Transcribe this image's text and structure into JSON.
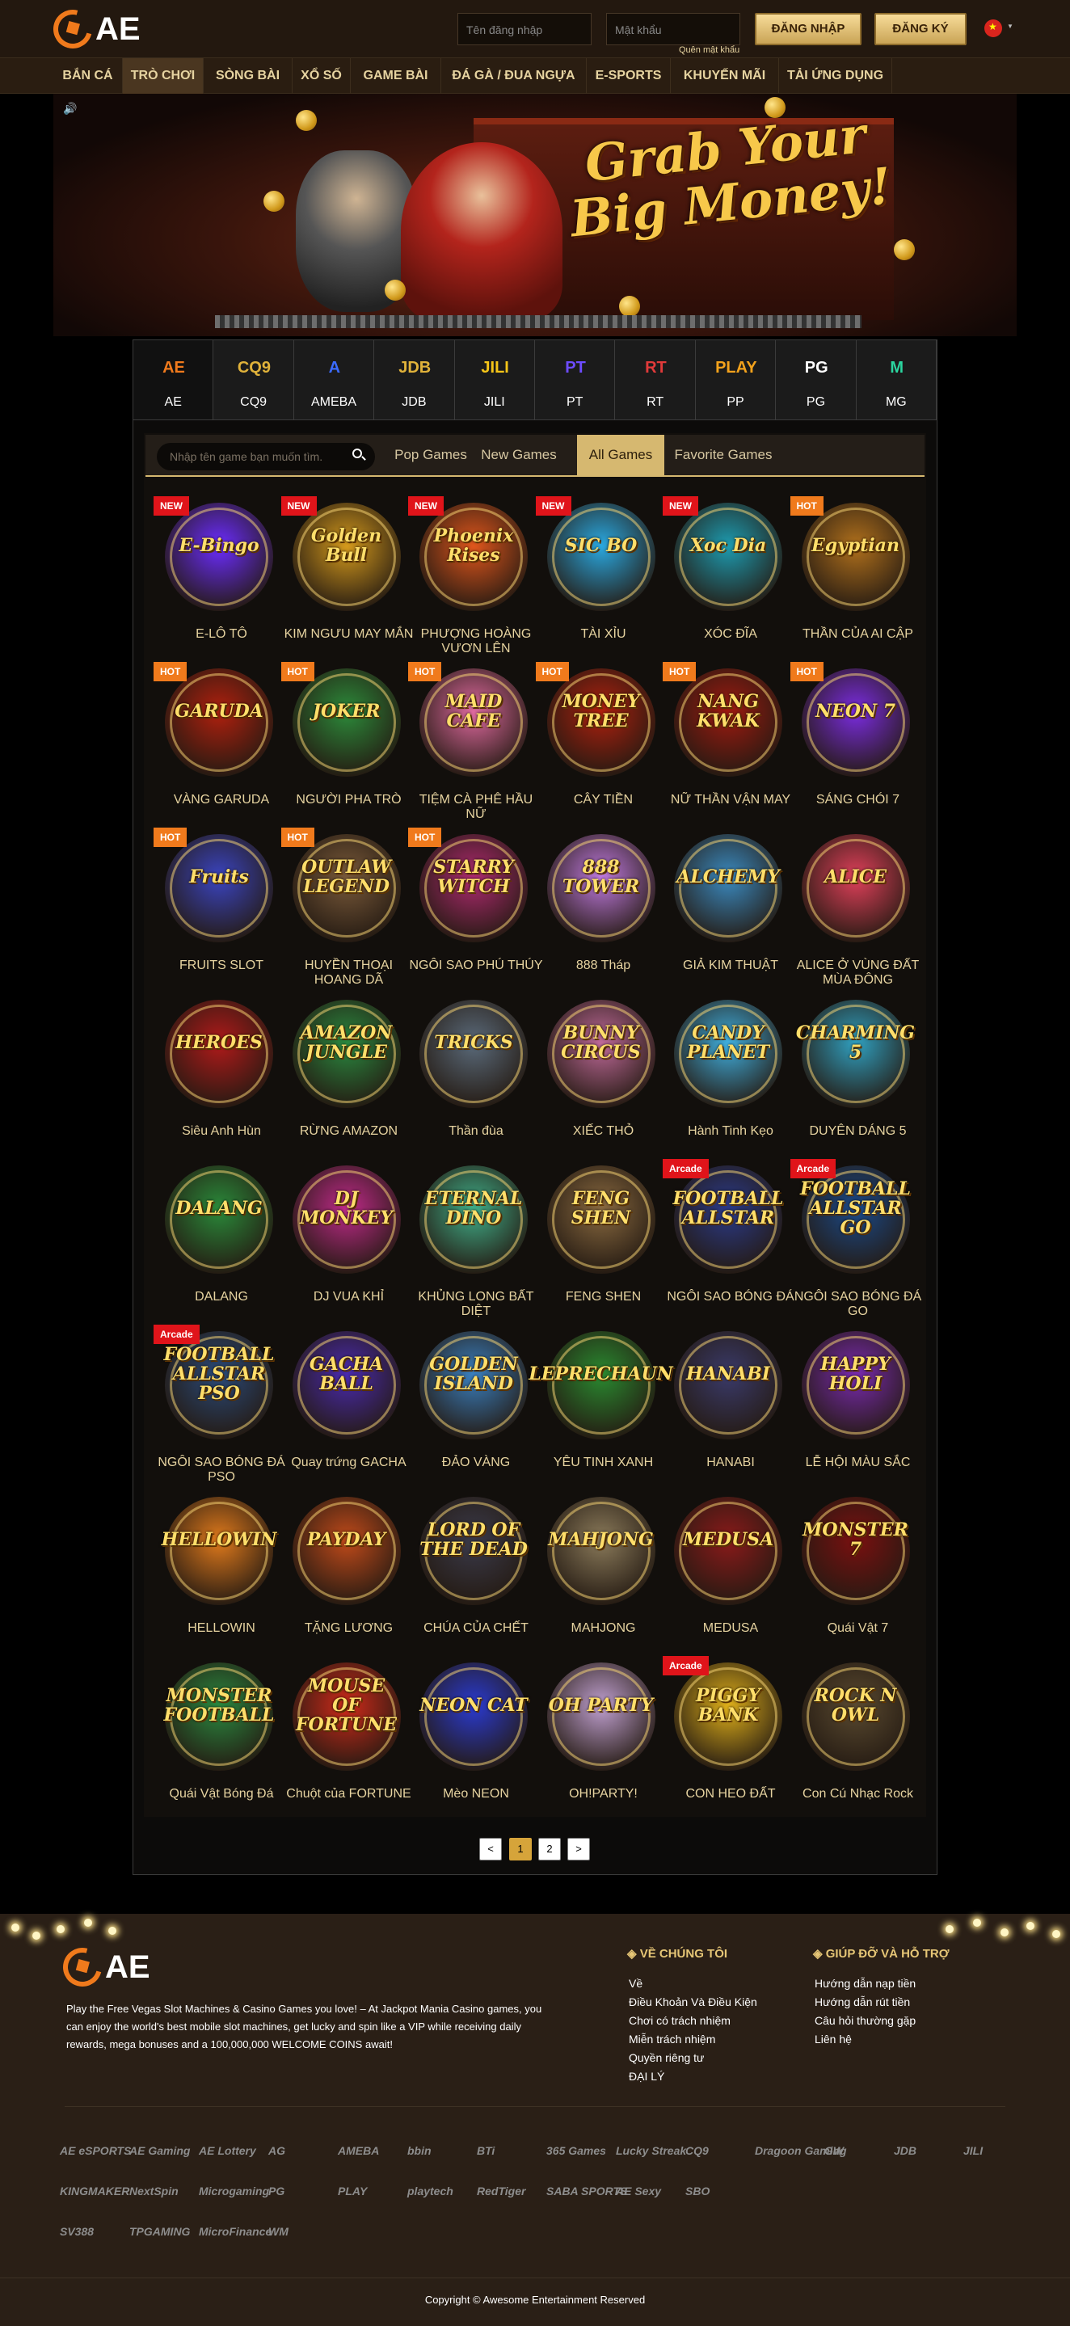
{
  "header": {
    "logo_text": "AE",
    "username_placeholder": "Tên đăng nhập",
    "password_placeholder": "Mật khẩu",
    "forgot_password": "Quên mật khẩu",
    "login_button": "ĐĂNG NHẬP",
    "register_button": "ĐĂNG KÝ",
    "flag_icon": "vietnam-flag-icon",
    "accent": "#d6b870"
  },
  "nav": {
    "items": [
      "BẮN CÁ",
      "TRÒ CHƠI",
      "SÒNG BÀI",
      "XỔ SỐ",
      "GAME BÀI",
      "ĐÁ GÀ / ĐUA NGỰA",
      "E-SPORTS",
      "KHUYẾN MÃI",
      "TẢI ỨNG DỤNG"
    ],
    "active_index": 1
  },
  "banner": {
    "headline": "Grab Your Big Money!",
    "sound_icon": "speaker-icon"
  },
  "providers": {
    "items": [
      {
        "label": "AE",
        "logo": "AE",
        "color": "#f07a1c"
      },
      {
        "label": "CQ9",
        "logo": "CQ9",
        "color": "#e0b23a"
      },
      {
        "label": "AMEBA",
        "logo": "A",
        "color": "#3b6bff"
      },
      {
        "label": "JDB",
        "logo": "JDB",
        "color": "#e0b23a"
      },
      {
        "label": "JILI",
        "logo": "JILI",
        "color": "#f5c518"
      },
      {
        "label": "PT",
        "logo": "PT",
        "color": "#6d4cff"
      },
      {
        "label": "RT",
        "logo": "RT",
        "color": "#e03a3a"
      },
      {
        "label": "PP",
        "logo": "PLAY",
        "color": "#f3a21c"
      },
      {
        "label": "PG",
        "logo": "PG",
        "color": "#ffffff"
      },
      {
        "label": "MG",
        "logo": "M",
        "color": "#2bd6a0"
      }
    ],
    "active_index": 0
  },
  "game_filters": {
    "search_placeholder": "Nhập tên game bạn muốn tìm.",
    "tabs": [
      "Pop Games",
      "New Games",
      "All Games",
      "Favorite Games"
    ],
    "active_index": 2
  },
  "games": [
    {
      "name": "E-LÔ TÔ",
      "badge": "NEW",
      "art": "E-Bingo",
      "color": "#6b2cff"
    },
    {
      "name": "KIM NGƯU MAY MẮN",
      "badge": "NEW",
      "art": "Golden Bull",
      "color": "#d59a1c"
    },
    {
      "name": "PHƯỢNG HOÀNG VƯƠN LÊN",
      "badge": "NEW",
      "art": "Phoenix Rises",
      "color": "#e0561c"
    },
    {
      "name": "TÀI XỈU",
      "badge": "NEW",
      "art": "SIC BO",
      "color": "#2aa8e0"
    },
    {
      "name": "XÓC ĐĨA",
      "badge": "NEW",
      "art": "Xoc Dia",
      "color": "#1d9bb0"
    },
    {
      "name": "THẦN CỦA AI CẬP",
      "badge": "HOT",
      "art": "Egyptian",
      "color": "#b0701c"
    },
    {
      "name": "VÀNG GARUDA",
      "badge": "HOT",
      "art": "GARUDA",
      "color": "#b0200e"
    },
    {
      "name": "NGƯỜI PHA TRÒ",
      "badge": "HOT",
      "art": "JOKER",
      "color": "#2c8a3a"
    },
    {
      "name": "TIỆM CÀ PHÊ HẦU NỮ",
      "badge": "HOT",
      "art": "MAID CAFE",
      "color": "#e06aa0"
    },
    {
      "name": "CÂY TIỀN",
      "badge": "HOT",
      "art": "MONEY TREE",
      "color": "#b0200e"
    },
    {
      "name": "NỮ THẦN VẬN MAY",
      "badge": "HOT",
      "art": "NANG KWAK",
      "color": "#a01a10"
    },
    {
      "name": "SÁNG CHÓI 7",
      "badge": "HOT",
      "art": "NEON 7",
      "color": "#7a2ce0"
    },
    {
      "name": "FRUITS SLOT",
      "badge": "HOT",
      "art": "Fruits",
      "color": "#3a44c0"
    },
    {
      "name": "HUYỀN THOẠI HOANG DÃ",
      "badge": "HOT",
      "art": "OUTLAW LEGEND",
      "color": "#7a5a3a"
    },
    {
      "name": "NGÔI SAO PHÚ THÚY",
      "badge": "HOT",
      "art": "STARRY WITCH",
      "color": "#b02a70"
    },
    {
      "name": "888 Tháp",
      "badge": "",
      "art": "888 TOWER",
      "color": "#c07ae0"
    },
    {
      "name": "GIẢ KIM THUẬT",
      "badge": "",
      "art": "ALCHEMY",
      "color": "#3a8ac0"
    },
    {
      "name": "ALICE Ở VÙNG ĐẤT MÙA ĐÔNG",
      "badge": "",
      "art": "ALICE",
      "color": "#e0405a"
    },
    {
      "name": "Siêu Anh Hùn",
      "badge": "",
      "art": "HEROES",
      "color": "#b01a1a"
    },
    {
      "name": "RỪNG AMAZON",
      "badge": "",
      "art": "AMAZON JUNGLE",
      "color": "#2a8a40"
    },
    {
      "name": "Thần đùa",
      "badge": "",
      "art": "TRICKS",
      "color": "#5a6a7a"
    },
    {
      "name": "XIẾC THỎ",
      "badge": "",
      "art": "BUNNY CIRCUS",
      "color": "#c06a9a"
    },
    {
      "name": "Hành Tinh Kẹo",
      "badge": "",
      "art": "CANDY PLANET",
      "color": "#40b0e0"
    },
    {
      "name": "DUYÊN DÁNG 5",
      "badge": "",
      "art": "CHARMING 5",
      "color": "#30a0c0"
    },
    {
      "name": "DALANG",
      "badge": "",
      "art": "DALANG",
      "color": "#2a8a3a"
    },
    {
      "name": "DJ VUA KHỈ",
      "badge": "",
      "art": "DJ MONKEY",
      "color": "#c02a8a"
    },
    {
      "name": "KHỦNG LONG BẤT DIỆT",
      "badge": "",
      "art": "ETERNAL DINO",
      "color": "#40b08a"
    },
    {
      "name": "FENG SHEN",
      "badge": "",
      "art": "FENG SHEN",
      "color": "#8a6a40"
    },
    {
      "name": "NGÔI SAO BÓNG ĐÁ",
      "badge": "Arcade",
      "art": "FOOTBALL ALLSTAR",
      "color": "#2a3a8a"
    },
    {
      "name": "NGÔI SAO BÓNG ĐÁ GO",
      "badge": "Arcade",
      "art": "FOOTBALL ALLSTAR GO",
      "color": "#1a4a8a"
    },
    {
      "name": "NGÔI SAO BÓNG ĐÁ PSO",
      "badge": "Arcade",
      "art": "FOOTBALL ALLSTAR PSO",
      "color": "#2a4a7a"
    },
    {
      "name": "Quay trứng GACHA",
      "badge": "",
      "art": "GACHA BALL",
      "color": "#4a2ab0"
    },
    {
      "name": "ĐẢO VÀNG",
      "badge": "",
      "art": "GOLDEN ISLAND",
      "color": "#3a80c0"
    },
    {
      "name": "YÊU TINH XANH",
      "badge": "",
      "art": "LEPRECHAUN",
      "color": "#2a8a30"
    },
    {
      "name": "HANABI",
      "badge": "",
      "art": "HANABI",
      "color": "#3a3a6a"
    },
    {
      "name": "LỄ HỘI MÀU SẮC",
      "badge": "",
      "art": "HAPPY HOLI",
      "color": "#7a2ab0"
    },
    {
      "name": "HELLOWIN",
      "badge": "",
      "art": "HELLOWIN",
      "color": "#e07a1c"
    },
    {
      "name": "TẶNG LƯƠNG",
      "badge": "",
      "art": "PAYDAY",
      "color": "#c04a1a"
    },
    {
      "name": "CHÚA CỦA CHẾT",
      "badge": "",
      "art": "LORD OF THE DEAD",
      "color": "#3a3a4a"
    },
    {
      "name": "MAHJONG",
      "badge": "",
      "art": "MAHJONG",
      "color": "#8a7a5a"
    },
    {
      "name": "MEDUSA",
      "badge": "",
      "art": "MEDUSA",
      "color": "#8a1a1a"
    },
    {
      "name": "Quái Vật 7",
      "badge": "",
      "art": "MONSTER 7",
      "color": "#7a1010"
    },
    {
      "name": "Quái Vật Bóng Đá",
      "badge": "",
      "art": "MONSTER FOOTBALL",
      "color": "#2a8a40"
    },
    {
      "name": "Chuột của FORTUNE",
      "badge": "",
      "art": "MOUSE OF FORTUNE",
      "color": "#d02a1a"
    },
    {
      "name": "Mèo NEON",
      "badge": "",
      "art": "NEON CAT",
      "color": "#2a3ad0"
    },
    {
      "name": "OH!PARTY!",
      "badge": "",
      "art": "OH PARTY",
      "color": "#c0a0d0"
    },
    {
      "name": "CON HEO ĐẤT",
      "badge": "Arcade",
      "art": "PIGGY BANK",
      "color": "#e0b01a"
    },
    {
      "name": "Con Cú Nhạc Rock",
      "badge": "",
      "art": "ROCK N OWL",
      "color": "#5a4a30"
    }
  ],
  "pagination": {
    "prev": "<",
    "pages": [
      "1",
      "2"
    ],
    "next": ">",
    "active": "1"
  },
  "footer": {
    "logo_text": "AE",
    "description": "Play the Free Vegas Slot Machines & Casino Games you love! – At Jackpot Mania Casino games, you can enjoy the world's best mobile slot machines, get lucky and spin like a VIP while receiving daily rewards, mega bonuses and a 100,000,000 WELCOME COINS await!",
    "about_title": "VỀ CHÚNG TÔI",
    "about_links": [
      "Về",
      "Điều Khoản Và Điều Kiện",
      "Chơi có trách nhiệm",
      "Miễn trách nhiệm",
      "Quyền riêng tư",
      "ĐẠI LÝ"
    ],
    "help_title": "GIÚP ĐỠ VÀ HỖ TRỢ",
    "help_links": [
      "Hướng dẫn nạp tiền",
      "Hướng dẫn rút tiền",
      "Câu hỏi thường gặp",
      "Liên hệ"
    ],
    "partners": [
      "AE eSPORTS",
      "AE Gaming",
      "AE Lottery",
      "AG",
      "AMEBA",
      "bbin",
      "BTi",
      "365 Games",
      "Lucky Streak",
      "CQ9",
      "Dragoon Gaming",
      "GW",
      "JDB",
      "JILI",
      "KINGMAKER",
      "NextSpin",
      "Microgaming",
      "PG",
      "PLAY",
      "playtech",
      "RedTiger",
      "SABA SPORTS",
      "AE Sexy",
      "SBO",
      "SV388",
      "TPGAMING",
      "MicroFinance",
      "WM"
    ],
    "copyright": "Copyright © Awesome Entertainment Reserved"
  }
}
